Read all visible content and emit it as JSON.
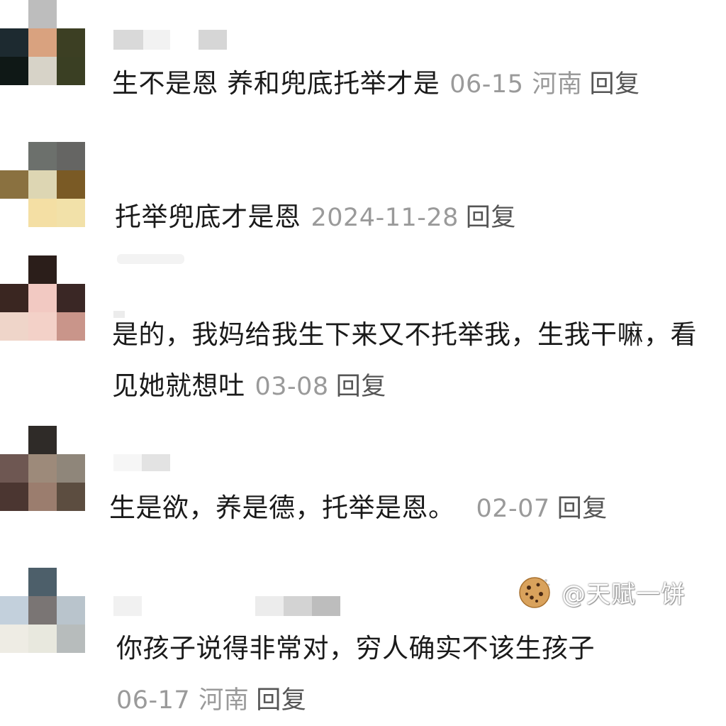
{
  "comments": [
    {
      "text": "生不是恩 养和兜底托举才是",
      "date": "06-15",
      "location": "河南",
      "reply": "回复",
      "avatar_colors": [
        "#ffffff",
        "#bdbdbd",
        "#ffffff",
        "#1d2a30",
        "#d9a27f",
        "#3c3f23",
        "#0f1816",
        "#d7d3c8",
        "#3a3f23"
      ]
    },
    {
      "text": "托举兜底才是恩",
      "date": "2024-11-28",
      "reply": "回复",
      "avatar_colors": [
        "#ffffff",
        "#6c706c",
        "#656563",
        "#8a7140",
        "#ddd6b3",
        "#7a5a25",
        "#ffffff",
        "#f4dfa4",
        "#f2e1a9"
      ]
    },
    {
      "text": "是的，我妈给我生下来又不托举我，生我干嘛，看见她就想吐",
      "date": "03-08",
      "reply": "回复",
      "avatar_colors": [
        "#ffffff",
        "#2b1e1a",
        "#ffffff",
        "#3a2621",
        "#f2c9c2",
        "#3a2725",
        "#efd5c9",
        "#f3d1c8",
        "#c9958a"
      ]
    },
    {
      "text": "生是欲，养是德，托举是恩。",
      "date": "02-07",
      "reply": "回复",
      "avatar_colors": [
        "#ffffff",
        "#2f2b28",
        "#ffffff",
        "#6e5752",
        "#9d8a7a",
        "#8f867a",
        "#4b3631",
        "#9b7d6e",
        "#5c4d40"
      ]
    },
    {
      "text": "你孩子说得非常对，穷人确实不该生孩子",
      "date": "06-17",
      "location": "河南",
      "reply": "回复",
      "avatar_colors": [
        "#ffffff",
        "#4d5f6a",
        "#ffffff",
        "#c3d0dc",
        "#7a7574",
        "#b9c4cc",
        "#eeece4",
        "#e8e8de",
        "#b7bcbc"
      ]
    }
  ],
  "watermark": {
    "text": "@天赋一饼",
    "icon": "cookie-icon"
  }
}
